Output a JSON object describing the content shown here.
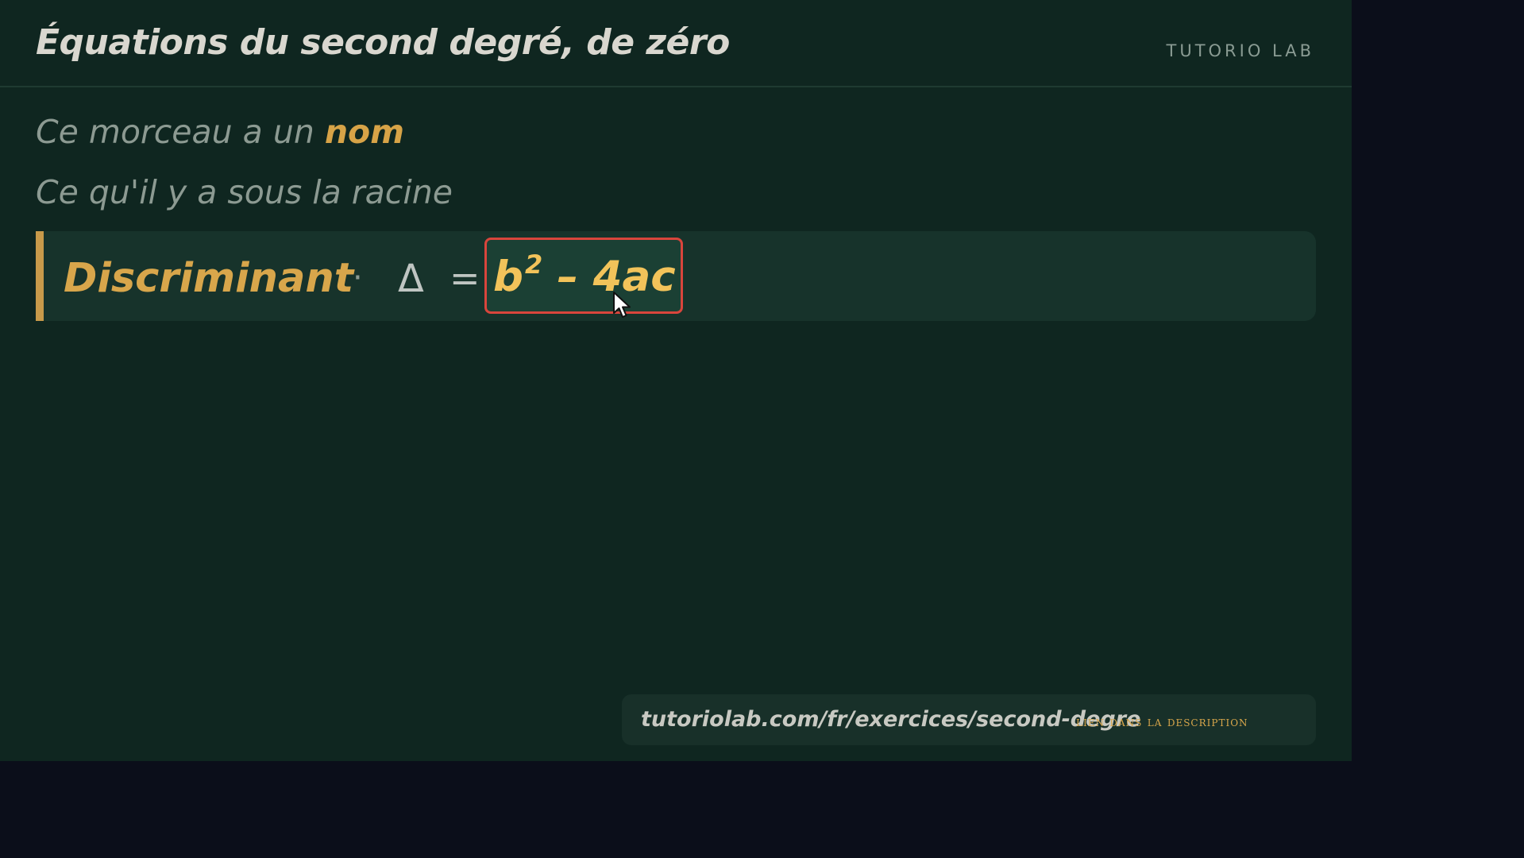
{
  "header": {
    "title": "Équations du second degré, de zéro",
    "brand": "TUTORIO LAB"
  },
  "intro": {
    "line1_prefix": "Ce morceau a un ",
    "line1_highlight": "nom",
    "line2": "Ce qu'il y a sous la racine"
  },
  "formula": {
    "name": "Discriminant",
    "separator": "·",
    "symbol": "Δ",
    "equals": "=",
    "expr_base": "b",
    "expr_exponent": "2",
    "expr_rest": " – 4ac"
  },
  "footer": {
    "url": "tutoriolab.com/fr/exercices/second-degre",
    "cta": "lien dans la description"
  },
  "colors": {
    "board": "#0f2620",
    "accent": "#d8a64b",
    "highlight_border": "#d9453c",
    "expression": "#f2c35a"
  }
}
